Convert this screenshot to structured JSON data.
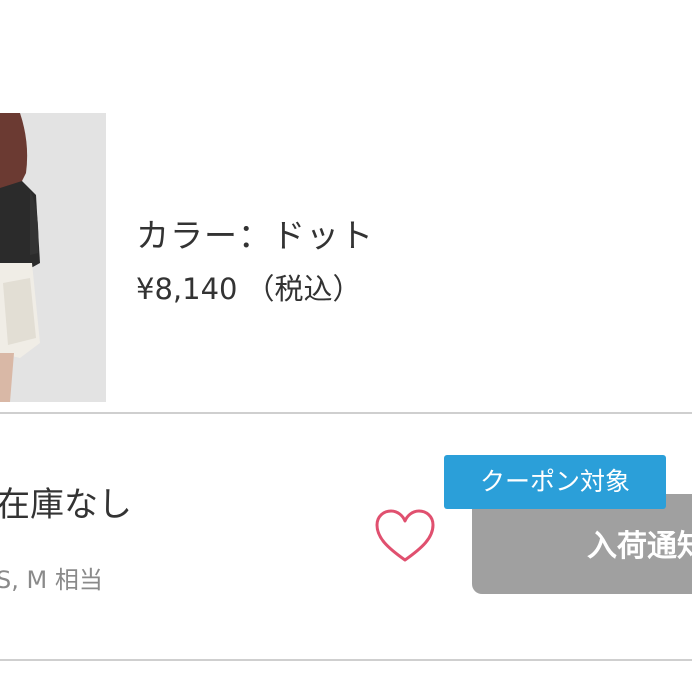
{
  "product": {
    "color_label": "カラー：ドット",
    "price": "¥8,140",
    "tax_note": "（税込）",
    "image_icon": "product-photo"
  },
  "stock": {
    "status": "在庫なし",
    "size_note": "S, M 相当"
  },
  "actions": {
    "favorite_icon": "heart-icon",
    "coupon_badge": "クーポン対象",
    "restock_button": "入荷通知"
  },
  "colors": {
    "coupon_blue": "#2b9fd9",
    "button_gray": "#a0a0a0",
    "heart_red": "#e0506f",
    "divider": "#cfcfcf"
  }
}
